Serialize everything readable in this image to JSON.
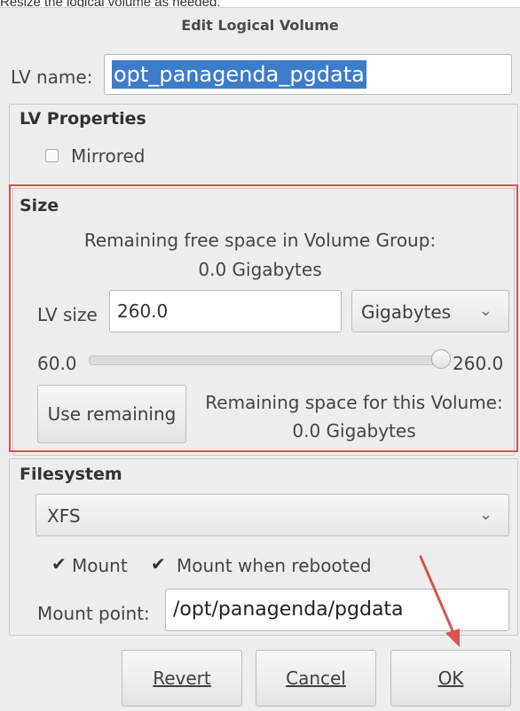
{
  "caption": "Resize the logical volume as needed.",
  "dialog_title": "Edit Logical Volume",
  "lv_name": {
    "label": "LV name:",
    "value": "opt_panagenda_pgdata"
  },
  "lv_properties": {
    "title": "LV Properties",
    "mirrored_label": "Mirrored",
    "mirrored_checked": false
  },
  "size": {
    "title": "Size",
    "free_space_line1": "Remaining free space in Volume Group:",
    "free_space_line2": "0.0 Gigabytes",
    "lv_size_label": "LV size",
    "lv_size_value": "260.0",
    "unit": "Gigabytes",
    "slider_min": "60.0",
    "slider_max": "260.0",
    "slider_fraction": 1.0,
    "use_remaining_label": "Use remaining",
    "remaining_volume_line1": "Remaining space for this Volume:",
    "remaining_volume_line2": "0.0 Gigabytes"
  },
  "filesystem": {
    "title": "Filesystem",
    "type": "XFS",
    "mount_label": "Mount",
    "mount_checked": true,
    "mount_rebooted_label": "Mount when rebooted",
    "mount_rebooted_checked": true,
    "mount_point_label": "Mount point:",
    "mount_point_value": "/opt/panagenda/pgdata"
  },
  "buttons": {
    "revert": "Revert",
    "cancel": "Cancel",
    "ok": "OK"
  },
  "annotation_color": "#d9534f",
  "selection_color": "#3d7cc9"
}
